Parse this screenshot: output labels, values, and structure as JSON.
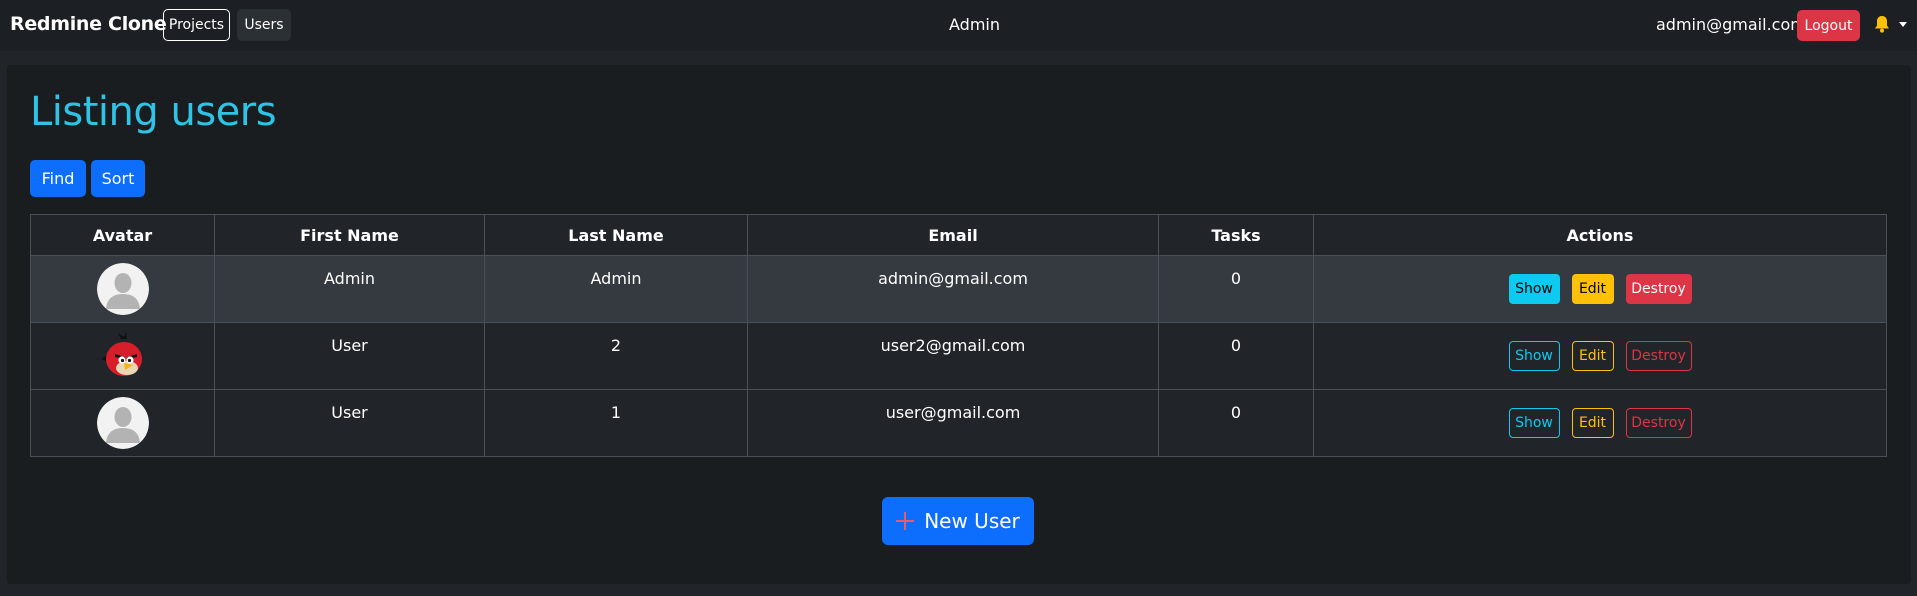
{
  "navbar": {
    "brand": "Redmine Clone",
    "links": [
      {
        "label": "Projects"
      },
      {
        "label": "Users"
      }
    ],
    "center_label": "Admin",
    "user_email": "admin@gmail.com",
    "logout_label": "Logout",
    "bell_icon": "bell-icon",
    "bell_color": "#ffc107"
  },
  "page": {
    "title": "Listing users",
    "find_label": "Find",
    "sort_label": "Sort",
    "new_user_label": "New User",
    "title_color": "#2fc3e6",
    "accent": "#0d6efd"
  },
  "table": {
    "columns": [
      "Avatar",
      "First Name",
      "Last Name",
      "Email",
      "Tasks",
      "Actions"
    ],
    "rows": [
      {
        "avatar": "default-avatar",
        "first_name": "Admin",
        "last_name": "Admin",
        "email": "admin@gmail.com",
        "tasks": "0",
        "show": "Show",
        "edit": "Edit",
        "destroy": "Destroy",
        "highlighted": true
      },
      {
        "avatar": "red-bird-avatar",
        "first_name": "User",
        "last_name": "2",
        "email": "user2@gmail.com",
        "tasks": "0",
        "show": "Show",
        "edit": "Edit",
        "destroy": "Destroy",
        "highlighted": false
      },
      {
        "avatar": "default-avatar",
        "first_name": "User",
        "last_name": "1",
        "email": "user@gmail.com",
        "tasks": "0",
        "show": "Show",
        "edit": "Edit",
        "destroy": "Destroy",
        "highlighted": false
      }
    ]
  }
}
